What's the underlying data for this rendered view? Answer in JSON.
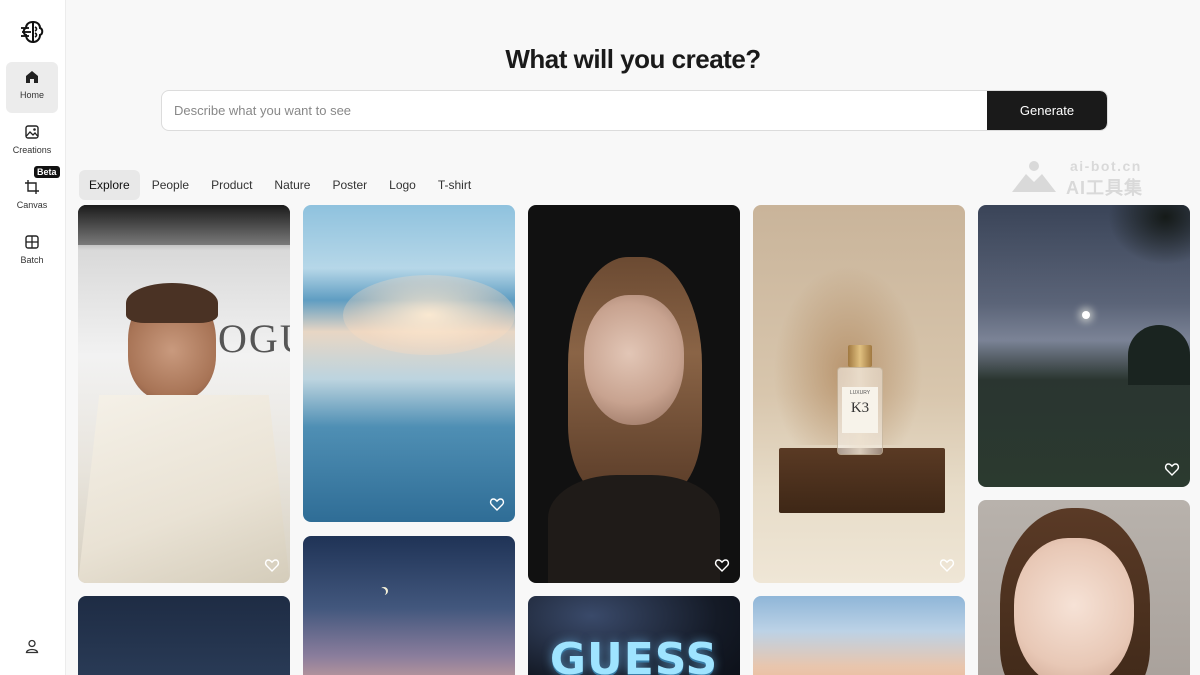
{
  "sidebar": {
    "items": [
      {
        "label": "Home",
        "icon": "home-icon",
        "active": true
      },
      {
        "label": "Creations",
        "icon": "image-icon",
        "active": false
      },
      {
        "label": "Canvas",
        "icon": "crop-icon",
        "active": false,
        "badge": "Beta"
      },
      {
        "label": "Batch",
        "icon": "grid-icon",
        "active": false
      }
    ],
    "user_icon": "user-icon"
  },
  "header": {
    "title": "What will you create?"
  },
  "prompt": {
    "placeholder": "Describe what you want to see",
    "value": "",
    "button_label": "Generate"
  },
  "tabs": [
    {
      "label": "Explore",
      "active": true
    },
    {
      "label": "People",
      "active": false
    },
    {
      "label": "Product",
      "active": false
    },
    {
      "label": "Nature",
      "active": false
    },
    {
      "label": "Poster",
      "active": false
    },
    {
      "label": "Logo",
      "active": false
    },
    {
      "label": "T-shirt",
      "active": false
    }
  ],
  "watermark": {
    "line1": "ai-bot.cn",
    "line2": "AI工具集"
  },
  "gallery": {
    "card_texts": {
      "vogue": "OGU",
      "guess": "GUESS",
      "k3": "K3",
      "k3_brand": "LUXURY"
    }
  },
  "colors": {
    "accent": "#1a1a1a",
    "background": "#f8f8f8",
    "sidebar_active": "#ececec"
  }
}
